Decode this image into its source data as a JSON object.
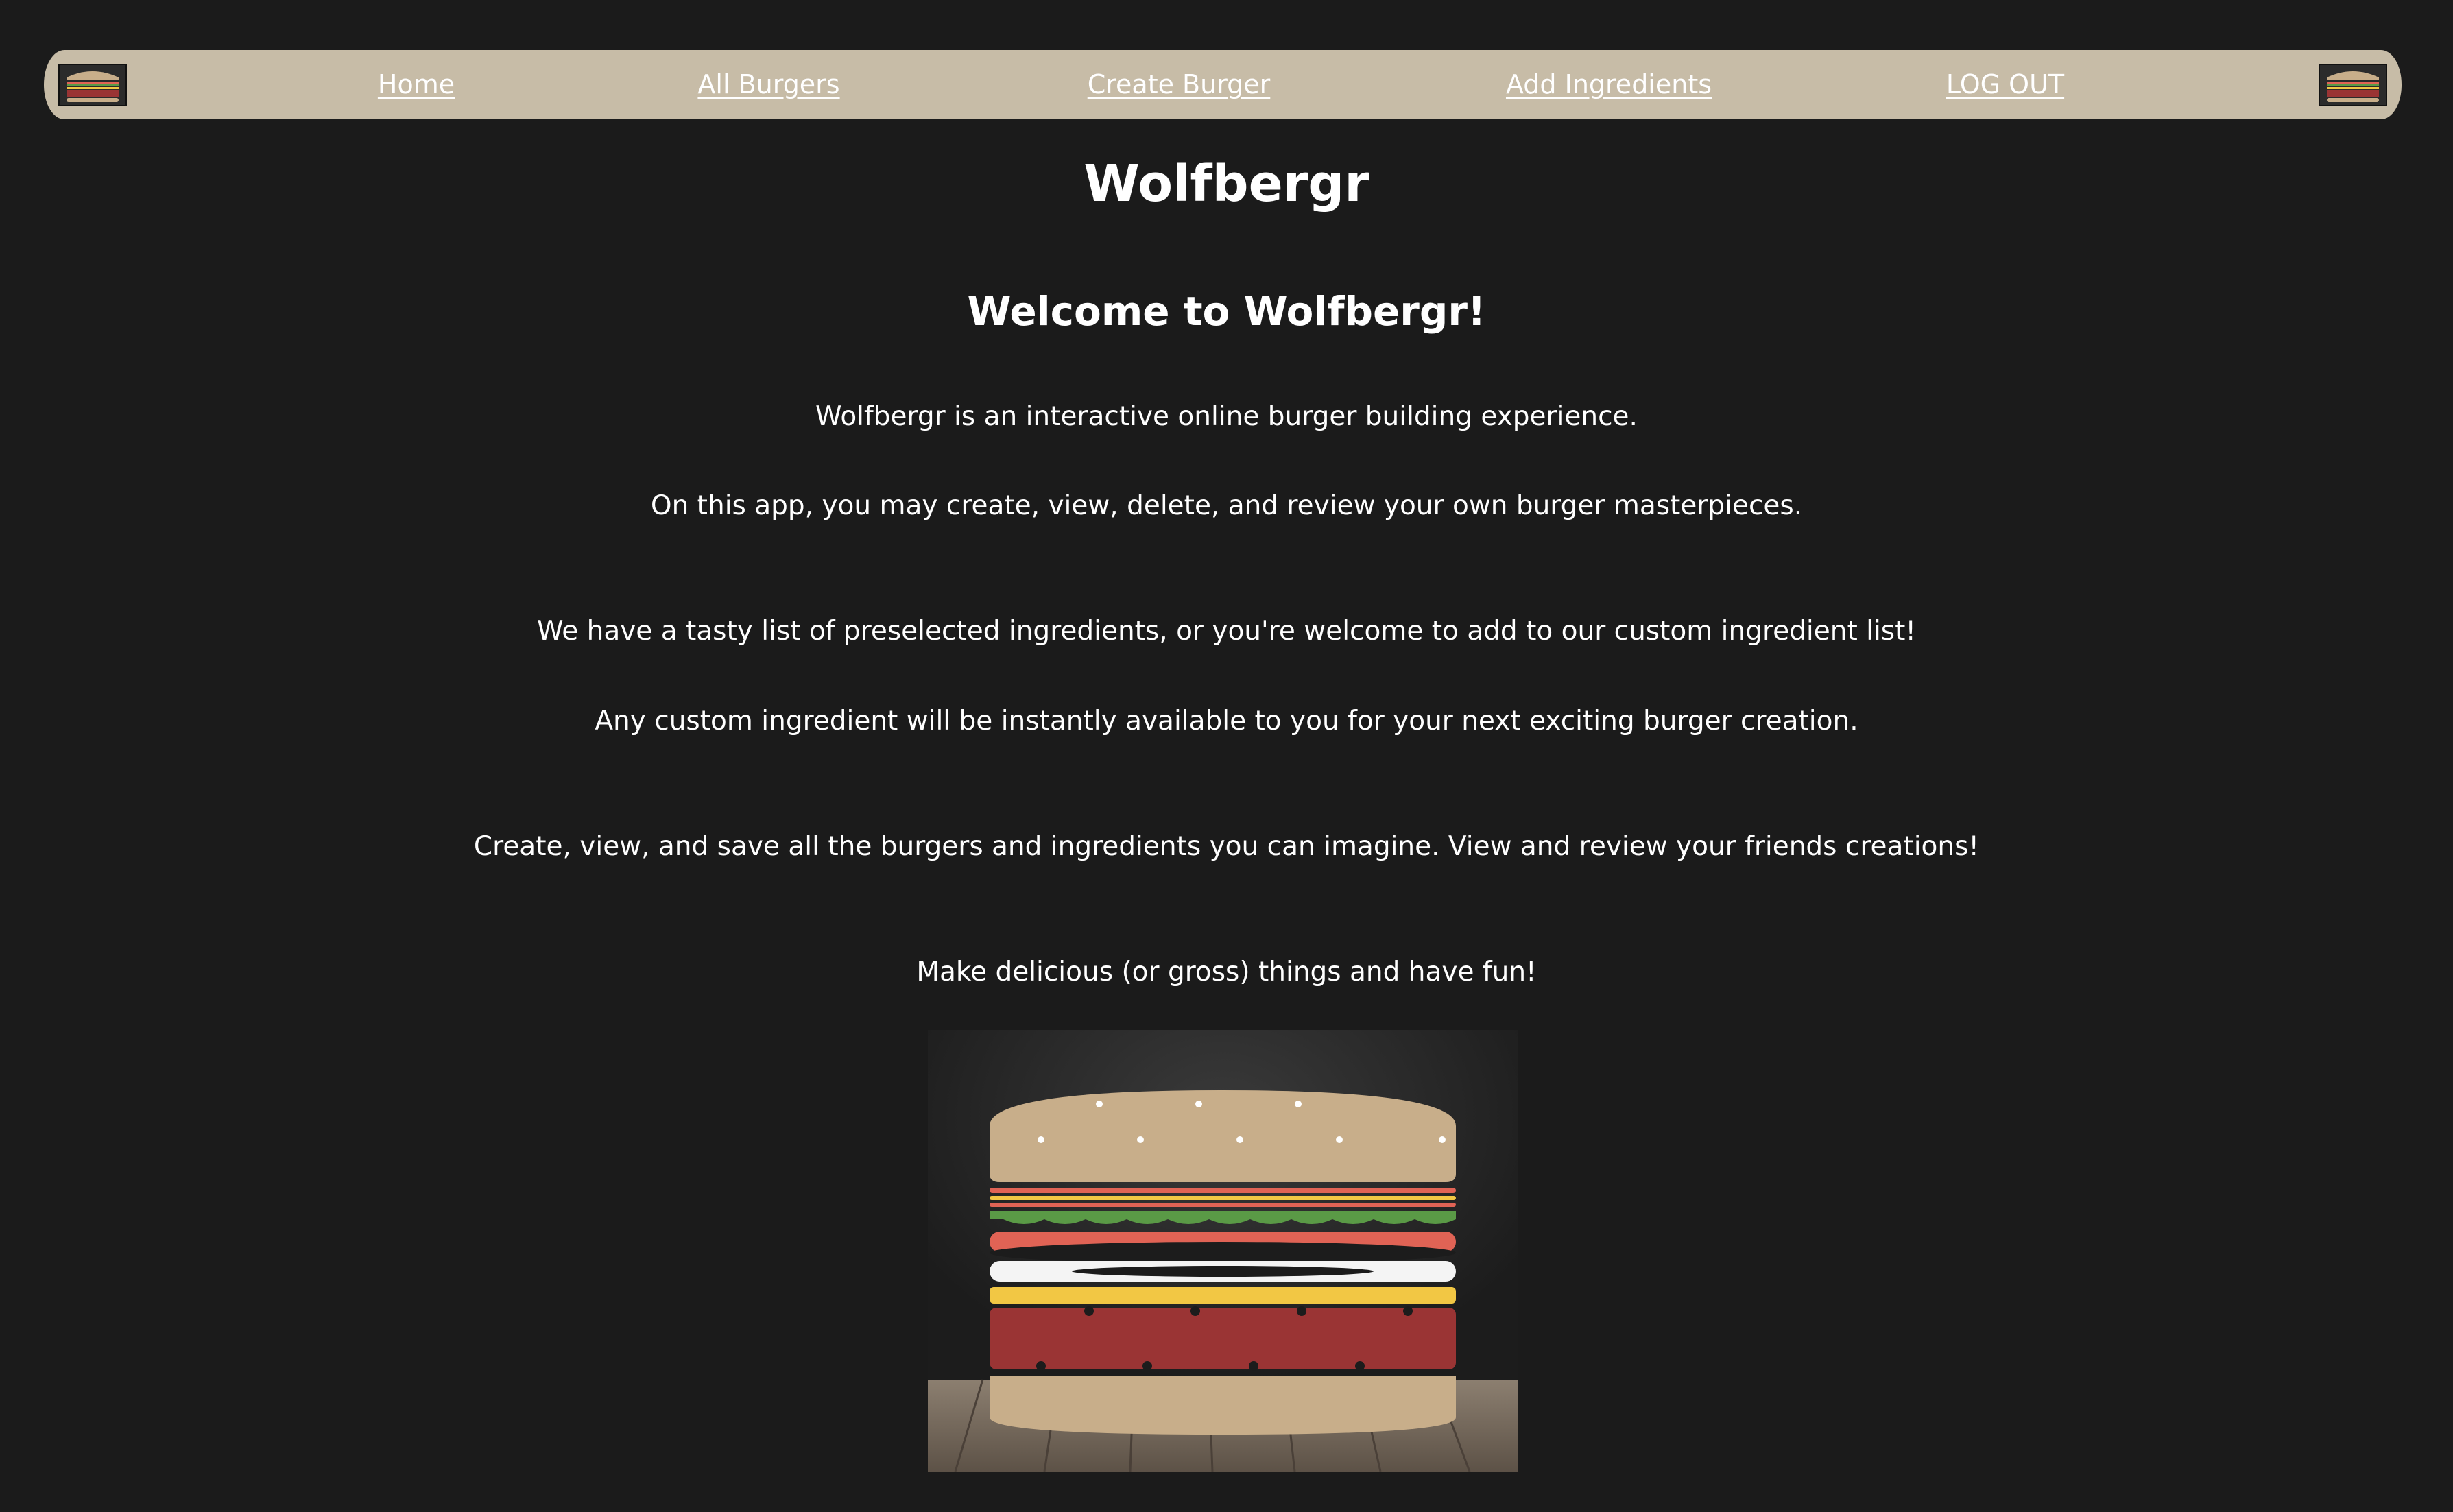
{
  "nav": {
    "links": [
      {
        "label": "Home"
      },
      {
        "label": "All Burgers"
      },
      {
        "label": "Create Burger"
      },
      {
        "label": "Add Ingredients"
      },
      {
        "label": "LOG OUT"
      }
    ],
    "logo_icon": "burger-icon"
  },
  "main": {
    "title": "Wolfbergr",
    "subtitle": "Welcome to Wolfbergr!",
    "paragraphs": [
      "Wolfbergr is an interactive online burger building experience.",
      "On this app, you may create, view, delete, and review your own burger masterpieces.",
      "We have a tasty list of preselected ingredients, or you're welcome to add to our custom ingredient list!",
      "Any custom ingredient will be instantly available to you for your next exciting burger creation.",
      "Create, view, and save all the burgers and ingredients you can imagine. View and review your friends creations!",
      "Make delicious (or gross) things and have fun!"
    ],
    "hero_image": "burger-illustration"
  },
  "colors": {
    "background": "#1b1b1b",
    "navbar": "#c7bca7",
    "text": "#ffffff",
    "bun": "#c8ae8a",
    "patty": "#9a3434",
    "cheese": "#f2c744",
    "lettuce": "#5a9a46",
    "tomato": "#e06355"
  }
}
